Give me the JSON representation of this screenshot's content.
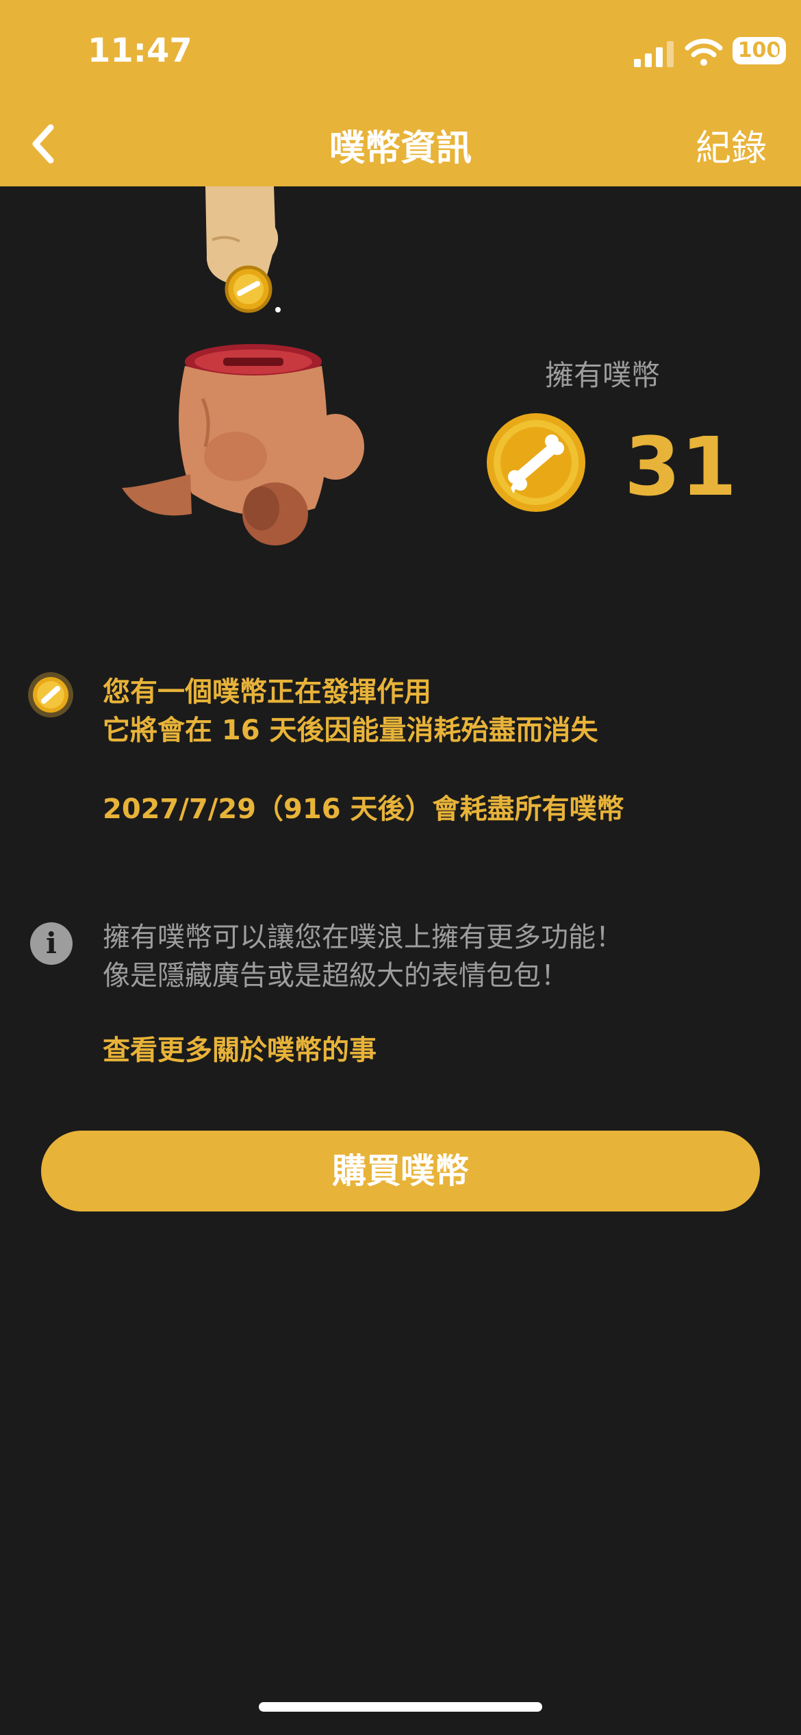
{
  "status_bar": {
    "time": "11:47",
    "battery": "100"
  },
  "nav": {
    "title": "噗幣資訊",
    "right_label": "紀錄"
  },
  "balance": {
    "label": "擁有噗幣",
    "count": "31"
  },
  "active_coin": {
    "line1": "您有一個噗幣正在發揮作用",
    "line2": "它將會在 16 天後因能量消耗殆盡而消失",
    "expiry": "2027/7/29（916 天後）會耗盡所有噗幣"
  },
  "about": {
    "line1": "擁有噗幣可以讓您在噗浪上擁有更多功能！",
    "line2": "像是隱藏廣告或是超級大的表情包包！",
    "link": "查看更多關於噗幣的事"
  },
  "buy_button": {
    "label": "購買噗幣"
  },
  "colors": {
    "accent": "#e8b339",
    "background": "#1b1b1b",
    "muted": "#9d9d9d"
  },
  "icons": [
    "back-chevron-icon",
    "coin-icon",
    "info-icon",
    "piggy-bank-illustration"
  ]
}
